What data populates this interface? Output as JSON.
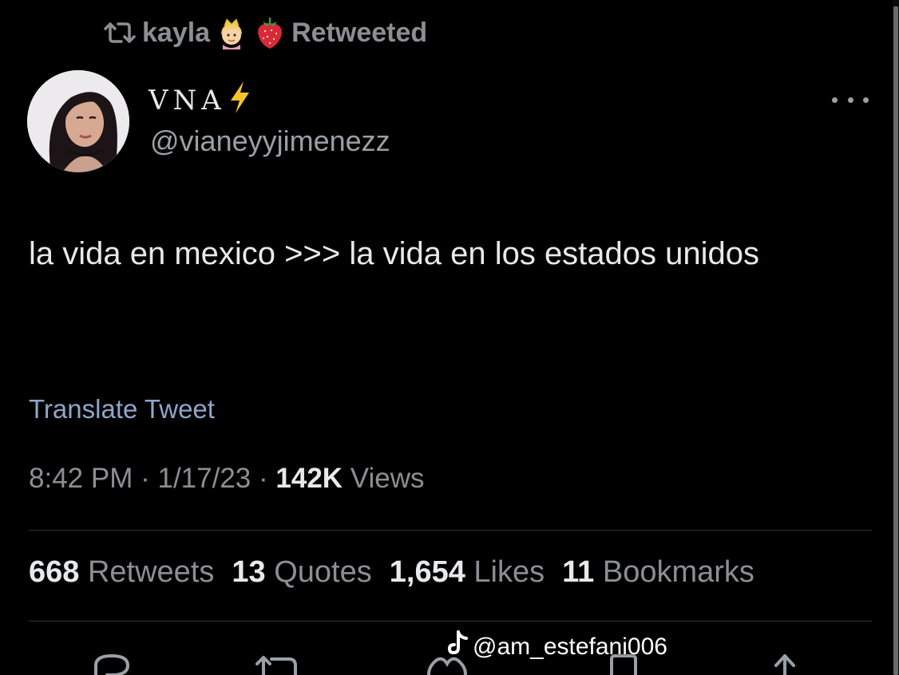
{
  "retweet_context": {
    "user": "kayla",
    "label": "Retweeted",
    "emojis": [
      "princess-emoji",
      "strawberry-emoji"
    ]
  },
  "author": {
    "name": "VNA",
    "name_emoji": "⚡",
    "handle": "@vianeyyjimenezz"
  },
  "tweet": {
    "text": "la vida en mexico >>> la vida en los estados unidos",
    "translate_label": "Translate Tweet",
    "time": "8:42 PM",
    "date": "1/17/23",
    "views_count": "142K",
    "views_label": "Views"
  },
  "stats": {
    "retweets_count": "668",
    "retweets_label": "Retweets",
    "quotes_count": "13",
    "quotes_label": "Quotes",
    "likes_count": "1,654",
    "likes_label": "Likes",
    "bookmarks_count": "11",
    "bookmarks_label": "Bookmarks"
  },
  "watermark": {
    "handle": "@am_estefani006",
    "icon": "tiktok-icon"
  },
  "colors": {
    "background": "#000000",
    "text": "#e7e9ea",
    "muted": "#8b8f94",
    "link": "#8fa6c9",
    "divider": "#2f3336"
  }
}
